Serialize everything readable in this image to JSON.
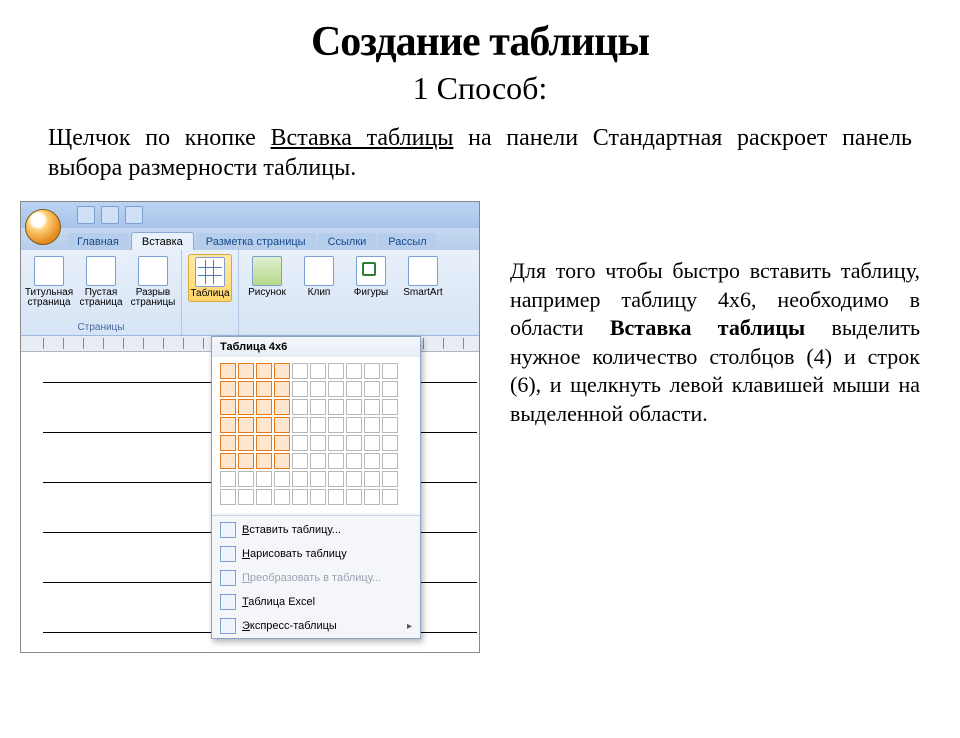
{
  "title": "Создание таблицы",
  "subtitle": "1 Способ:",
  "intro_pre": "Щелчок по кнопке ",
  "intro_underlined": "Вставка таблицы",
  "intro_post": " на панели Стандартная раскроет панель выбора размерности таблицы.",
  "side_pre": "Для того чтобы быстро вставить таблицу, например таблицу 4х6, необходимо в области ",
  "side_bold": "Вставка таблицы",
  "side_post": " выделить нужное количество столбцов (4) и строк (6), и щелкнуть левой клавишей мыши на выделенной области.",
  "word": {
    "tabs": [
      "Главная",
      "Вставка",
      "Разметка страницы",
      "Ссылки",
      "Рассыл"
    ],
    "active_tab_index": 1,
    "group_pages_caption": "Страницы",
    "btn_cover": "Титульная\nстраница",
    "btn_blank": "Пустая\nстраница",
    "btn_break": "Разрыв\nстраницы",
    "btn_table": "Таблица",
    "btn_picture": "Рисунок",
    "btn_clip": "Клип",
    "btn_shapes": "Фигуры",
    "btn_smartart": "SmartArt",
    "dropdown": {
      "title": "Таблица 4x6",
      "cols_selected": 4,
      "rows_selected": 6,
      "grid_cols": 10,
      "grid_rows": 8,
      "items": [
        {
          "label_pre": "",
          "hot": "В",
          "label_post": "ставить таблицу...",
          "disabled": false,
          "arrow": false
        },
        {
          "label_pre": "",
          "hot": "Н",
          "label_post": "арисовать таблицу",
          "disabled": false,
          "arrow": false
        },
        {
          "label_pre": "",
          "hot": "П",
          "label_post": "реобразовать в таблицу...",
          "disabled": true,
          "arrow": false
        },
        {
          "label_pre": "",
          "hot": "Т",
          "label_post": "аблица Excel",
          "disabled": false,
          "arrow": false
        },
        {
          "label_pre": "",
          "hot": "Э",
          "label_post": "кспресс-таблицы",
          "disabled": false,
          "arrow": true
        }
      ]
    }
  }
}
